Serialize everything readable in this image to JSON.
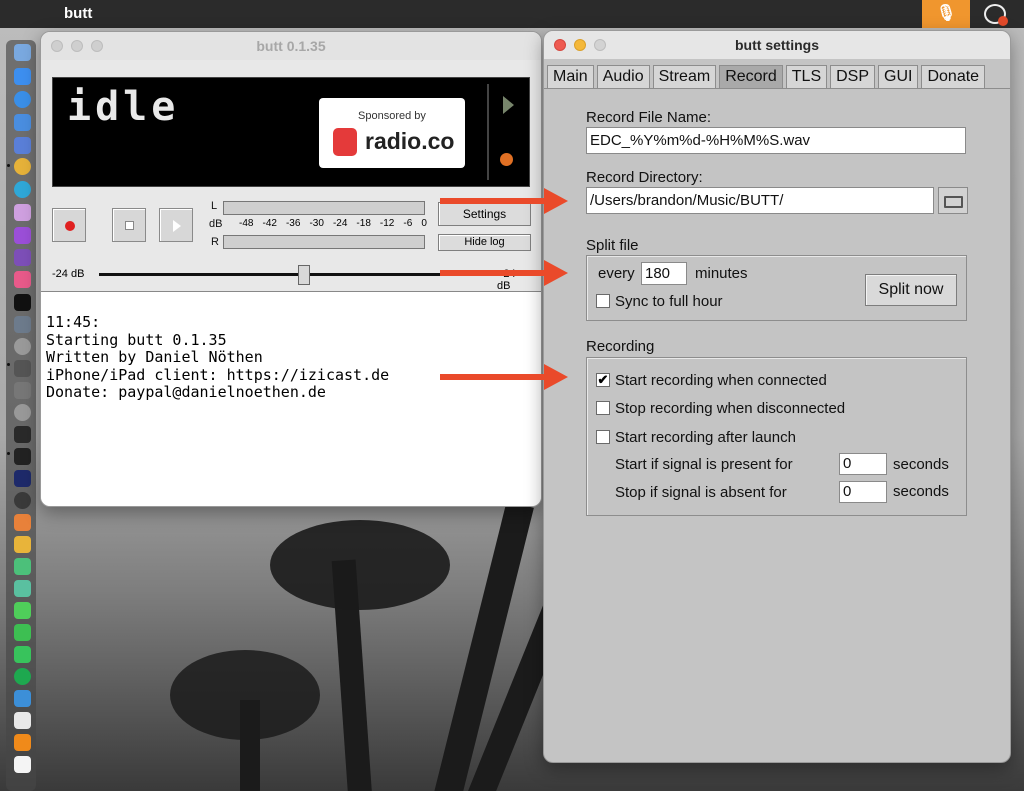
{
  "menubar": {
    "app_name": "butt"
  },
  "main_window": {
    "title": "butt 0.1.35",
    "status_text": "idle",
    "sponsor": {
      "caption": "Sponsored by",
      "brand": "radio.co"
    },
    "vu": {
      "left": "L",
      "db": "dB",
      "right": "R",
      "scale": [
        "-48",
        "-42",
        "-36",
        "-30",
        "-24",
        "-18",
        "-12",
        "-6",
        "0"
      ]
    },
    "settings_label": "Settings",
    "hide_log_label": "Hide log",
    "gain_min": "-24 dB",
    "gain_max": "+24 dB",
    "gain_level": 0.5,
    "log": "11:45:\nStarting butt 0.1.35\nWritten by Daniel Nöthen\niPhone/iPad client: https://izicast.de\nDonate: paypal@danielnoethen.de"
  },
  "settings_window": {
    "title": "butt settings",
    "tabs": [
      "Main",
      "Audio",
      "Stream",
      "Record",
      "TLS",
      "DSP",
      "GUI",
      "Donate"
    ],
    "active_tab": "Record",
    "record_file_name": {
      "label": "Record File Name:",
      "value": "EDC_%Y%m%d-%H%M%S.wav"
    },
    "record_directory": {
      "label": "Record Directory:",
      "value": "/Users/brandon/Music/BUTT/"
    },
    "split": {
      "label": "Split file",
      "every_label": "every",
      "every_value": "180",
      "minutes_label": "minutes",
      "sync_label": "Sync to full hour",
      "sync_checked": false,
      "split_now_label": "Split now"
    },
    "recording": {
      "label": "Recording",
      "start_connected": {
        "label": "Start recording when connected",
        "checked": true
      },
      "stop_disconnected": {
        "label": "Stop recording when disconnected",
        "checked": false
      },
      "start_launch": {
        "label": "Start recording after launch",
        "checked": false
      },
      "signal_present": {
        "label": "Start if signal is present for",
        "value": "0",
        "unit": "seconds"
      },
      "signal_absent": {
        "label": "Stop if signal is absent for",
        "value": "0",
        "unit": "seconds"
      }
    },
    "check_mark": "✔"
  },
  "colors": {
    "arrow": "#ea4a2a",
    "display_bg": "#000000",
    "record_red": "#e02020"
  }
}
